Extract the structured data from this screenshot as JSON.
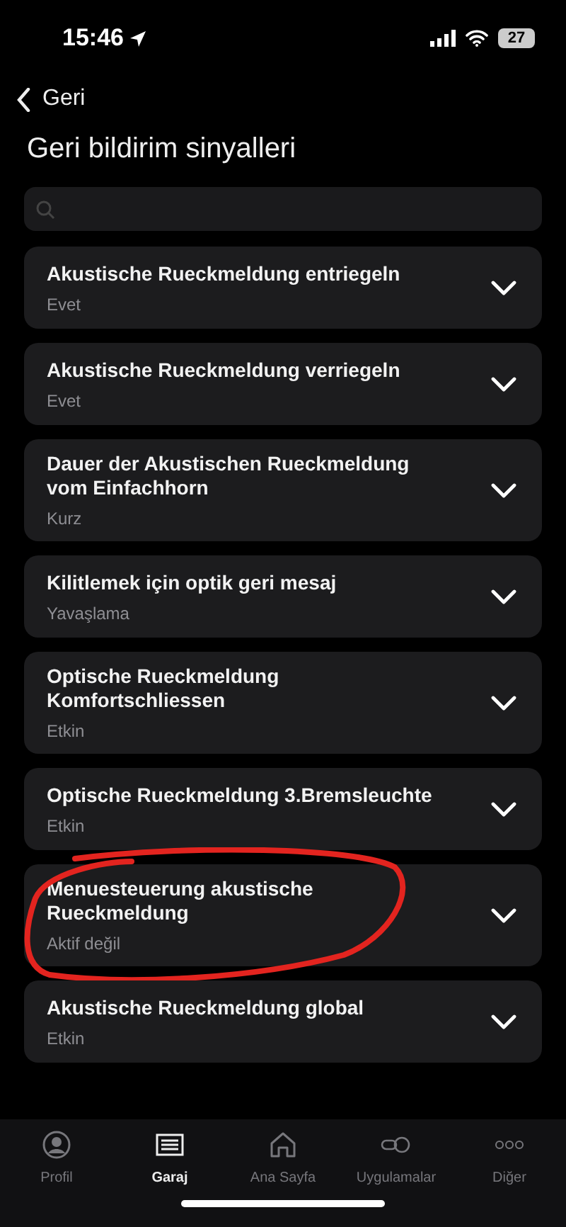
{
  "status_bar": {
    "time": "15:46",
    "battery": "27"
  },
  "nav": {
    "back": "Geri",
    "title": "Geri bildirim sinyalleri"
  },
  "items": [
    {
      "title": "Akustische Rueckmeldung entriegeln",
      "value": "Evet",
      "circled": false
    },
    {
      "title": "Akustische Rueckmeldung verriegeln",
      "value": "Evet",
      "circled": false
    },
    {
      "title": "Dauer der Akustischen Rueckmeldung vom Einfachhorn",
      "value": "Kurz",
      "circled": false
    },
    {
      "title": "Kilitlemek için optik geri mesaj",
      "value": "Yavaşlama",
      "circled": false
    },
    {
      "title": "Optische Rueckmeldung Komfortschliessen",
      "value": "Etkin",
      "circled": false
    },
    {
      "title": "Optische Rueckmeldung 3.Bremsleuchte",
      "value": "Etkin",
      "circled": false
    },
    {
      "title": "Menuesteuerung akustische Rueckmeldung",
      "value": "Aktif değil",
      "circled": true
    },
    {
      "title": "Akustische Rueckmeldung global",
      "value": "Etkin",
      "circled": false
    }
  ],
  "tab_bar": [
    {
      "kind": "profile",
      "label": "Profil",
      "selected": false
    },
    {
      "kind": "garage",
      "label": "Garaj",
      "selected": true
    },
    {
      "kind": "home",
      "label": "Ana Sayfa",
      "selected": false
    },
    {
      "kind": "apps",
      "label": "Uygulamalar",
      "selected": false
    },
    {
      "kind": "more",
      "label": "Diğer",
      "selected": false
    }
  ]
}
